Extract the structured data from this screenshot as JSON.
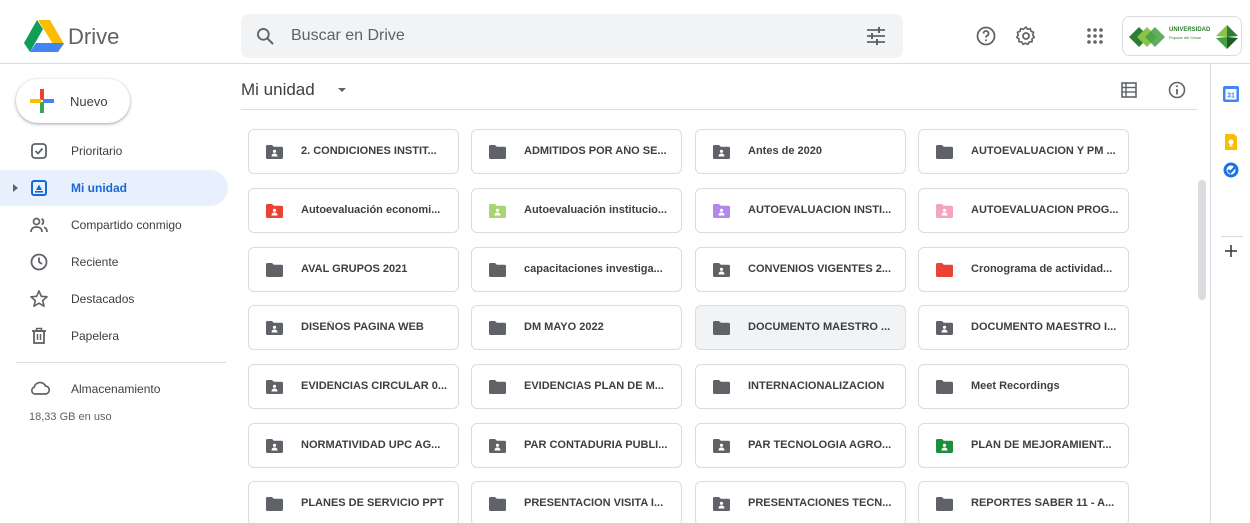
{
  "app": {
    "name": "Drive"
  },
  "search": {
    "placeholder": "Buscar en Drive",
    "value": ""
  },
  "header_icons": [
    "help-icon",
    "settings-icon",
    "apps-grid-icon"
  ],
  "account": {
    "name": "UNIVERSIDAD",
    "subtitle": "Popular del Cesar"
  },
  "sidebar": {
    "new_label": "Nuevo",
    "items": [
      {
        "label": "Prioritario",
        "icon": "priority-icon",
        "active": false
      },
      {
        "label": "Mi unidad",
        "icon": "my-drive-icon",
        "active": true
      },
      {
        "label": "Compartido conmigo",
        "icon": "shared-icon",
        "active": false
      },
      {
        "label": "Reciente",
        "icon": "clock-icon",
        "active": false
      },
      {
        "label": "Destacados",
        "icon": "star-icon",
        "active": false
      },
      {
        "label": "Papelera",
        "icon": "trash-icon",
        "active": false
      }
    ],
    "storage_label": "Almacenamiento",
    "storage_used": "18,33 GB en uso"
  },
  "main": {
    "title": "Mi unidad",
    "folders": [
      {
        "name": "2. CONDICIONES INSTIT...",
        "shared": true,
        "color": "#5f6368"
      },
      {
        "name": "ADMITIDOS POR AÑO SE...",
        "shared": false,
        "color": "#5f6368"
      },
      {
        "name": "Antes de 2020",
        "shared": true,
        "color": "#5f6368"
      },
      {
        "name": "AUTOEVALUACION Y PM ...",
        "shared": false,
        "color": "#5f6368"
      },
      {
        "name": "Autoevaluación economi...",
        "shared": true,
        "color": "#ea4335"
      },
      {
        "name": "Autoevaluación institucio...",
        "shared": true,
        "color": "#a8d472"
      },
      {
        "name": "AUTOEVALUACION INSTI...",
        "shared": true,
        "color": "#b388eb"
      },
      {
        "name": "AUTOEVALUACION PROG...",
        "shared": true,
        "color": "#f4a3c0"
      },
      {
        "name": "AVAL GRUPOS 2021",
        "shared": false,
        "color": "#5f6368"
      },
      {
        "name": "capacitaciones investiga...",
        "shared": false,
        "color": "#5f6368"
      },
      {
        "name": "CONVENIOS VIGENTES 2...",
        "shared": true,
        "color": "#5f6368"
      },
      {
        "name": "Cronograma de actividad...",
        "shared": false,
        "color": "#ea4335"
      },
      {
        "name": "DISEÑOS PAGINA WEB",
        "shared": true,
        "color": "#5f6368"
      },
      {
        "name": "DM MAYO 2022",
        "shared": false,
        "color": "#5f6368"
      },
      {
        "name": "DOCUMENTO MAESTRO ...",
        "shared": false,
        "color": "#5f6368",
        "selected": true
      },
      {
        "name": "DOCUMENTO MAESTRO I...",
        "shared": true,
        "color": "#5f6368"
      },
      {
        "name": "EVIDENCIAS CIRCULAR 0...",
        "shared": true,
        "color": "#5f6368"
      },
      {
        "name": "EVIDENCIAS PLAN DE M...",
        "shared": false,
        "color": "#5f6368"
      },
      {
        "name": "INTERNACIONALIZACION",
        "shared": false,
        "color": "#5f6368"
      },
      {
        "name": "Meet Recordings",
        "shared": false,
        "color": "#5f6368"
      },
      {
        "name": "NORMATIVIDAD UPC AG...",
        "shared": true,
        "color": "#5f6368"
      },
      {
        "name": "PAR CONTADURIA PUBLI...",
        "shared": true,
        "color": "#5f6368"
      },
      {
        "name": "PAR TECNOLOGIA AGRO...",
        "shared": true,
        "color": "#5f6368"
      },
      {
        "name": "PLAN DE MEJORAMIENT...",
        "shared": true,
        "color": "#1e8e3e"
      },
      {
        "name": "PLANES DE SERVICIO PPT",
        "shared": false,
        "color": "#5f6368"
      },
      {
        "name": "PRESENTACION VISITA I...",
        "shared": false,
        "color": "#5f6368"
      },
      {
        "name": "PRESENTACIONES TECN...",
        "shared": true,
        "color": "#5f6368"
      },
      {
        "name": "REPORTES SABER 11 - A...",
        "shared": false,
        "color": "#5f6368"
      }
    ]
  },
  "side_panel": {
    "icons": [
      "calendar-icon",
      "keep-icon",
      "tasks-icon",
      "add-icon"
    ],
    "calendar_day": "31"
  }
}
